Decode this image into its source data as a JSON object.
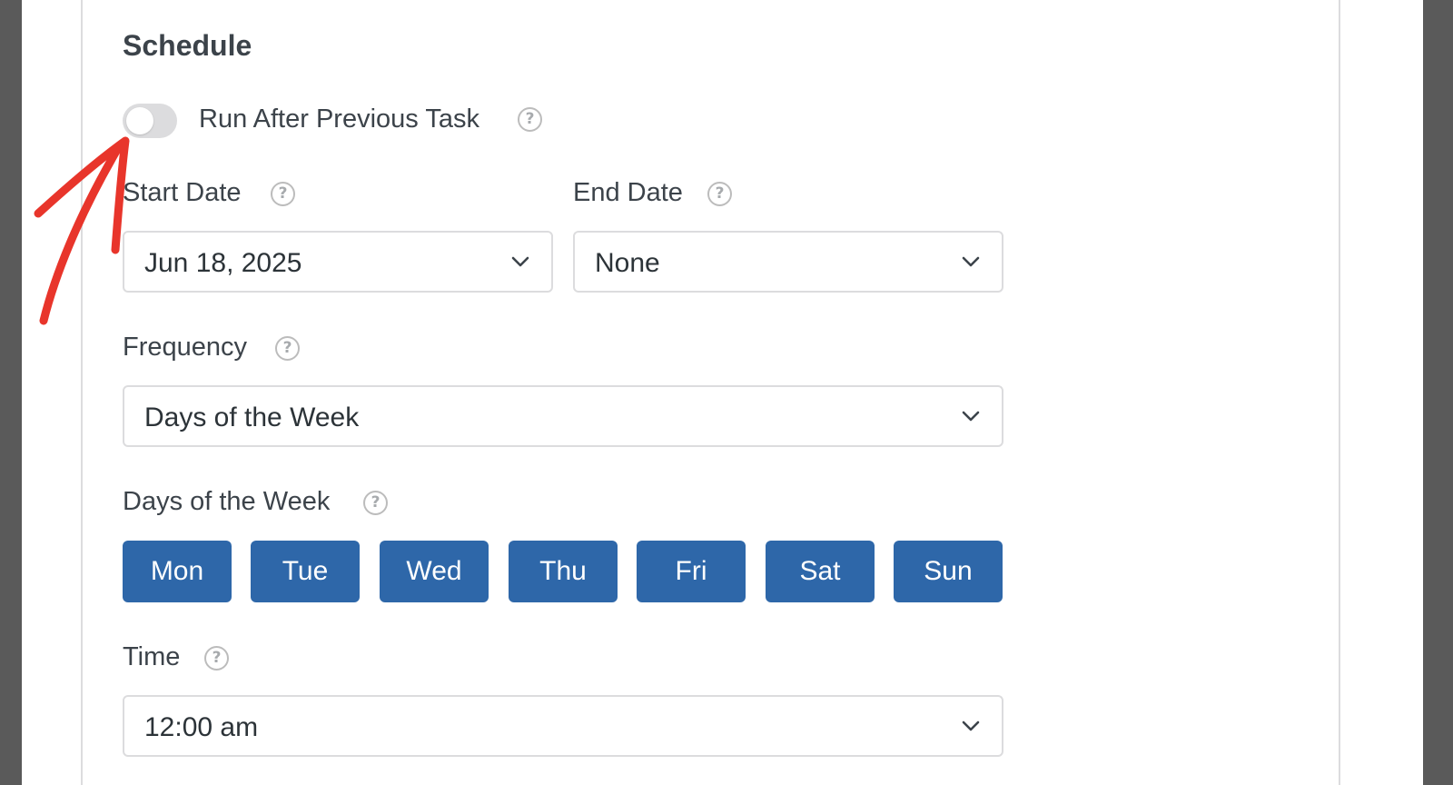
{
  "schedule": {
    "title": "Schedule",
    "run_after_previous": {
      "label": "Run After Previous Task",
      "enabled": false
    },
    "start_date": {
      "label": "Start Date",
      "value": "Jun 18, 2025"
    },
    "end_date": {
      "label": "End Date",
      "value": "None"
    },
    "frequency": {
      "label": "Frequency",
      "value": "Days of the Week"
    },
    "days_of_week": {
      "label": "Days of the Week",
      "days": [
        "Mon",
        "Tue",
        "Wed",
        "Thu",
        "Fri",
        "Sat",
        "Sun"
      ]
    },
    "time": {
      "label": "Time",
      "value": "12:00 am"
    }
  },
  "icons": {
    "help": "help-circle-icon",
    "chevron": "chevron-down-icon",
    "annotation": "red-arrow-annotation"
  },
  "colors": {
    "accent": "#2e67a9",
    "toggle_off": "#dcdcde",
    "annotation": "#e8352b"
  }
}
